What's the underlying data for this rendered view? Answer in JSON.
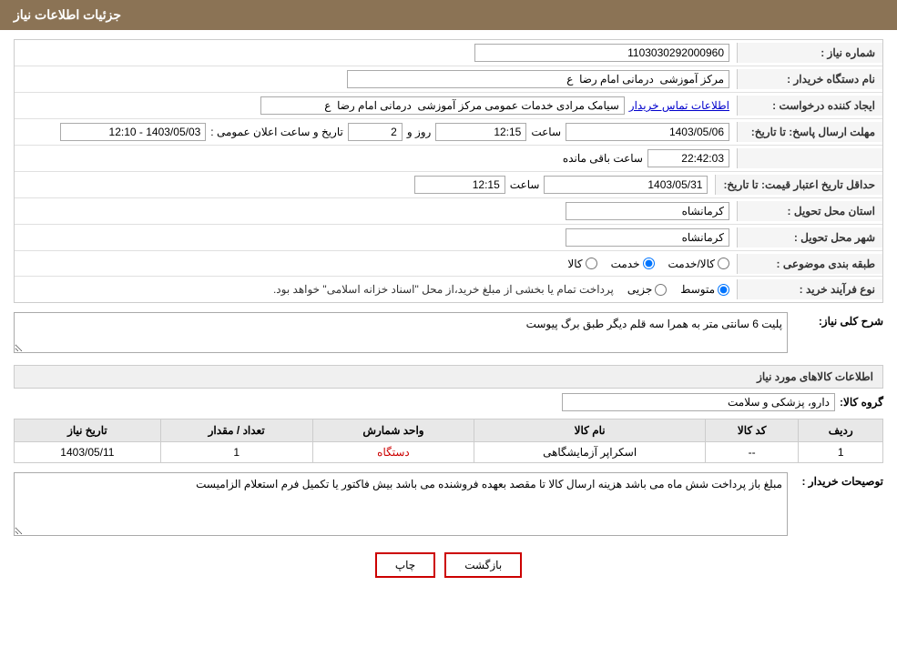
{
  "header": {
    "title": "جزئیات اطلاعات نیاز"
  },
  "fields": {
    "shomareNiaz_label": "شماره نیاز :",
    "shomareNiaz_value": "1103030292000960",
    "namDastgah_label": "نام دستگاه خریدار :",
    "namDastgah_value": "مرکز آموزشی  درمانی امام رضا  ع",
    "ijadKonande_label": "ایجاد کننده درخواست :",
    "ijadKonande_value": "سیامک مرادی خدمات عمومی مرکز آموزشی  درمانی امام رضا  ع",
    "ijadKonande_link": "اطلاعات تماس خریدار",
    "mohlatErsalPasokh_label": "مهلت ارسال پاسخ: تا تاریخ:",
    "mohlatErsalDate": "1403/05/06",
    "mohlatErsalSaatLabel": "ساعت",
    "mohlatErsalSaat": "12:15",
    "mohlatErsalRozLabel": "روز و",
    "mohlatErsalRoz": "2",
    "mohlatErsalMandeSaatLabel": "ساعت باقی مانده",
    "mohlatErsalMandeSaat": "22:42:03",
    "tarikhAlan_label": "تاریخ و ساعت اعلان عمومی :",
    "tarikhAlan_value": "1403/05/03 - 12:10",
    "hadaqalTarikh_label": "حداقل تاریخ اعتبار قیمت: تا تاریخ:",
    "hadaqalDate": "1403/05/31",
    "hadaqalSaatLabel": "ساعت",
    "hadaqalSaat": "12:15",
    "ostanTahvil_label": "استان محل تحویل :",
    "ostanTahvil_value": "کرمانشاه",
    "shahrTahvil_label": "شهر محل تحویل :",
    "shahrTahvil_value": "کرمانشاه",
    "tabagheBandi_label": "طبقه بندی موضوعی :",
    "tabagheBandi_kala": "کالا",
    "tabagheBandi_khadamat": "خدمت",
    "tabagheBandi_kalaKhadamat": "کالا/خدمت",
    "tabagheBandi_selected": "khadamat",
    "noveFaraindKharid_label": "نوع فرآیند خرید :",
    "noveFaraindKharid_jozee": "جزیی",
    "noveFaraindKharid_motavaset": "متوسط",
    "noveFaraindKharid_selected": "motavaset",
    "noveFaraindKharid_desc": "پرداخت تمام یا بخشی از مبلغ خرید،از محل \"اسناد خزانه اسلامی\" خواهد بود.",
    "sharhKolliNiaz_label": "شرح کلی نیاز:",
    "sharhKolliNiaz_value": "پلیت 6 سانتی متر به همرا سه قلم دیگر طبق برگ پیوست",
    "kalahaMordNiaz_title": "اطلاعات کالاهای مورد نیاز",
    "groupeKala_label": "گروه کالا:",
    "groupeKala_value": "دارو، پزشکی و سلامت",
    "table": {
      "headers": [
        "ردیف",
        "کد کالا",
        "نام کالا",
        "واحد شمارش",
        "تعداد / مقدار",
        "تاریخ نیاز"
      ],
      "rows": [
        {
          "radif": "1",
          "kodKala": "--",
          "namKala": "اسکراپر آزمایشگاهی",
          "vahadShomarash": "دستگاه",
          "tedad": "1",
          "tarikhNiaz": "1403/05/11"
        }
      ]
    },
    "tosaifKharidar_label": "توصیحات خریدار :",
    "tosaifKharidar_value": "مبلغ باز پرداخت شش ماه می باشد هزینه ارسال کالا تا مقصد بعهده فروشنده می باشد بیش فاکتور یا تکمیل فرم استعلام الزامیست"
  },
  "buttons": {
    "print": "چاپ",
    "back": "بازگشت"
  }
}
